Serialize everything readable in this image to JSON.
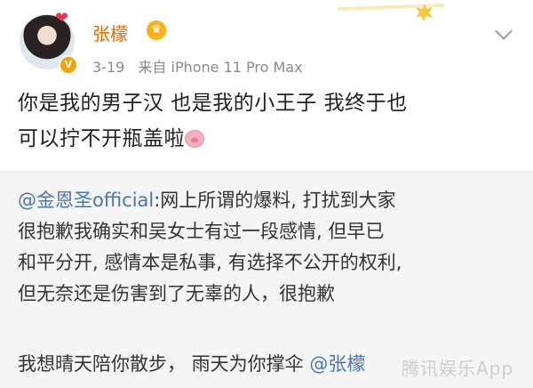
{
  "user": {
    "name": "张檬",
    "date": "3-19",
    "source": "来自 iPhone 11 Pro Max"
  },
  "post": {
    "line1": "你是我的男子汉  也是我的小王子  我终于也",
    "line2": "可以拧不开瓶盖啦"
  },
  "repost": {
    "mention": "@金恩圣official",
    "line1": ":网上所谓的爆料, 打扰到大家",
    "line2": "很抱歉我确实和吴女士有过一段感情, 但早已",
    "line3": "和平分开, 感情本是私事, 有选择不公开的权利,",
    "line4": "但无奈还是伤害到了无辜的人，很抱歉",
    "second_text": "我想晴天陪你散步，  雨天为你撑伞 ",
    "second_mention": "@张檬"
  },
  "watermark": "腾讯娱乐App",
  "icons": {
    "avatar": "avatar",
    "verified": "verified-badge-icon",
    "crown": "crown-icon",
    "pig": "pig-emoji-icon",
    "chevron": "chevron-down-icon",
    "bow": "bow-icon"
  },
  "colors": {
    "name": "#e66c00",
    "mention": "#4a77b3",
    "repost_bg": "#f5f5f5",
    "meta": "#8a8a8a"
  }
}
